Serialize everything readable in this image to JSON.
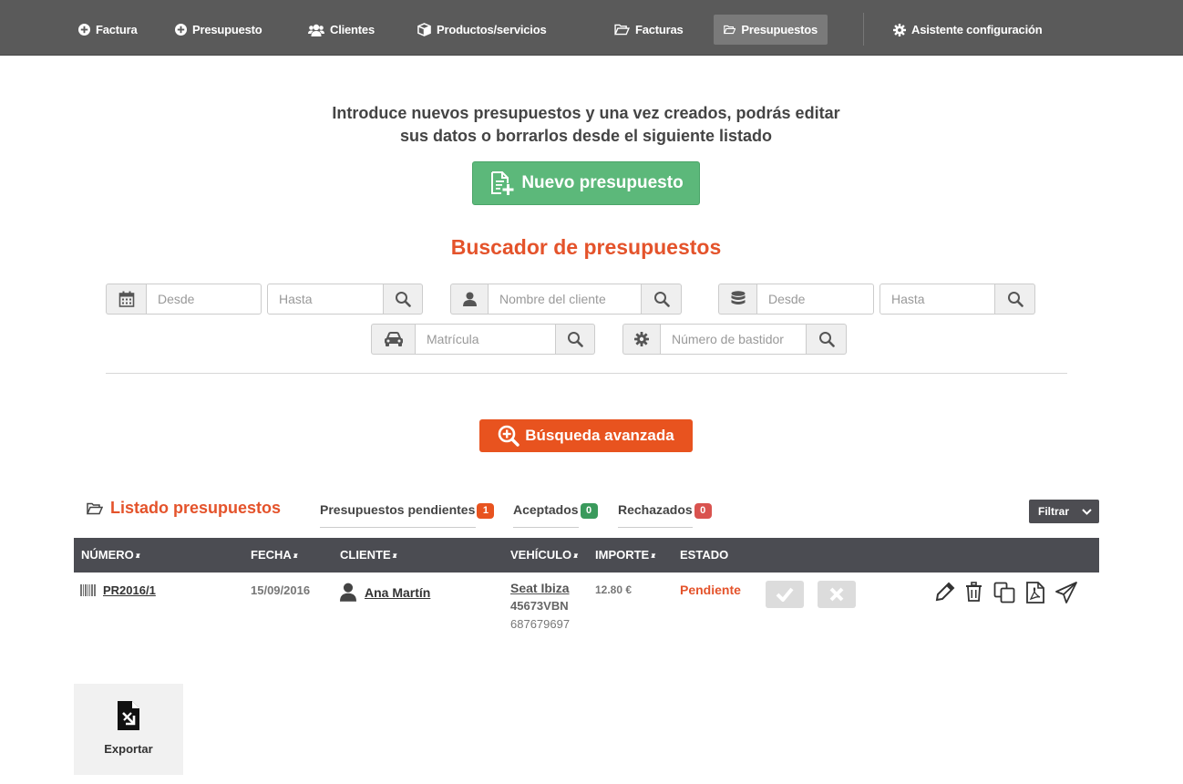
{
  "nav": {
    "items": [
      {
        "label": "Factura",
        "icon": "plus-circle-icon"
      },
      {
        "label": "Presupuesto",
        "icon": "plus-circle-icon"
      },
      {
        "label": "Clientes",
        "icon": "users-icon"
      },
      {
        "label": "Productos/servicios",
        "icon": "cube-icon"
      },
      {
        "label": "Facturas",
        "icon": "folder-open-icon"
      },
      {
        "label": "Presupuestos",
        "icon": "folder-open-icon",
        "active": true
      },
      {
        "label": "Asistente configuración",
        "icon": "gear-icon"
      }
    ]
  },
  "intro": {
    "line1": "Introduce nuevos presupuestos y una vez creados, podrás editar",
    "line2": "sus datos o borrarlos desde el siguiente listado"
  },
  "new_button": {
    "label": "Nuevo presupuesto"
  },
  "search": {
    "title": "Buscador de presupuestos",
    "date_from_placeholder": "Desde",
    "date_to_placeholder": "Hasta",
    "client_placeholder": "Nombre del cliente",
    "amount_from_placeholder": "Desde",
    "amount_to_placeholder": "Hasta",
    "plate_placeholder": "Matrícula",
    "chassis_placeholder": "Número de bastidor"
  },
  "advanced_button": {
    "label": "Búsqueda avanzada"
  },
  "list": {
    "title": "Listado presupuestos",
    "tabs": [
      {
        "label": "Presupuestos pendientes",
        "count": "1",
        "color": "#e8531f"
      },
      {
        "label": "Aceptados",
        "count": "0",
        "color": "#3a9a5c"
      },
      {
        "label": "Rechazados",
        "count": "0",
        "color": "#d9534f"
      }
    ],
    "filter_label": "Filtrar"
  },
  "table": {
    "columns": [
      "NÚMERO",
      "FECHA",
      "CLIENTE",
      "VEHÍCULO",
      "IMPORTE",
      "ESTADO"
    ],
    "rows": [
      {
        "number": "PR2016/1",
        "date": "15/09/2016",
        "client": "Ana Martín",
        "vehicle_model": "Seat Ibiza",
        "vehicle_plate": "45673VBN",
        "vehicle_phone": "687679697",
        "amount": "12.80 €",
        "status": "Pendiente"
      }
    ]
  },
  "export": {
    "label": "Exportar"
  },
  "colors": {
    "accent": "#e4532b",
    "primary_green": "#5cb87a",
    "nav_bg": "#5a5a5a",
    "table_header_bg": "#4b4c52"
  }
}
